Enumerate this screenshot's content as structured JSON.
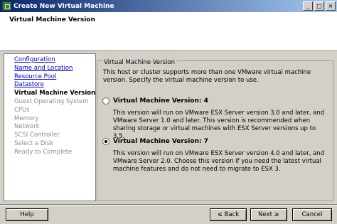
{
  "window": {
    "title": "Create New Virtual Machine"
  },
  "header": {
    "title": "Virtual Machine Version"
  },
  "nav": {
    "items": [
      {
        "label": "Configuration",
        "state": "link"
      },
      {
        "label": "Name and Location",
        "state": "link"
      },
      {
        "label": "Resource Pool",
        "state": "link"
      },
      {
        "label": "Datastore",
        "state": "link"
      },
      {
        "label": "Virtual Machine Version",
        "state": "current"
      },
      {
        "label": "Guest Operating System",
        "state": "disabled"
      },
      {
        "label": "CPUs",
        "state": "disabled"
      },
      {
        "label": "Memory",
        "state": "disabled"
      },
      {
        "label": "Network",
        "state": "disabled"
      },
      {
        "label": "SCSI Controller",
        "state": "disabled"
      },
      {
        "label": "Select a Disk",
        "state": "disabled"
      },
      {
        "label": "Ready to Complete",
        "state": "disabled"
      }
    ]
  },
  "main": {
    "group_label": "Virtual Machine Version",
    "intro": "This host or cluster supports more than one VMware virtual machine version. Specify the virtual machine version to use.",
    "options": [
      {
        "label": "Virtual Machine Version: 4",
        "checked": false,
        "description": "This version will run on VMware ESX Server version 3.0 and later, and VMware Server 1.0 and later. This version is recommended when sharing storage or virtual machines with ESX Server versions up to 3.5."
      },
      {
        "label": "Virtual Machine Version: 7",
        "checked": true,
        "description": "This version will run on VMware ESX Server version 4.0 and later, and VMware Server 2.0. Choose this version if you need the latest virtual machine features and do not need to migrate to ESX 3."
      }
    ]
  },
  "footer": {
    "help": "Help",
    "back": "≤ Back",
    "next": "Next ≥",
    "cancel": "Cancel"
  }
}
